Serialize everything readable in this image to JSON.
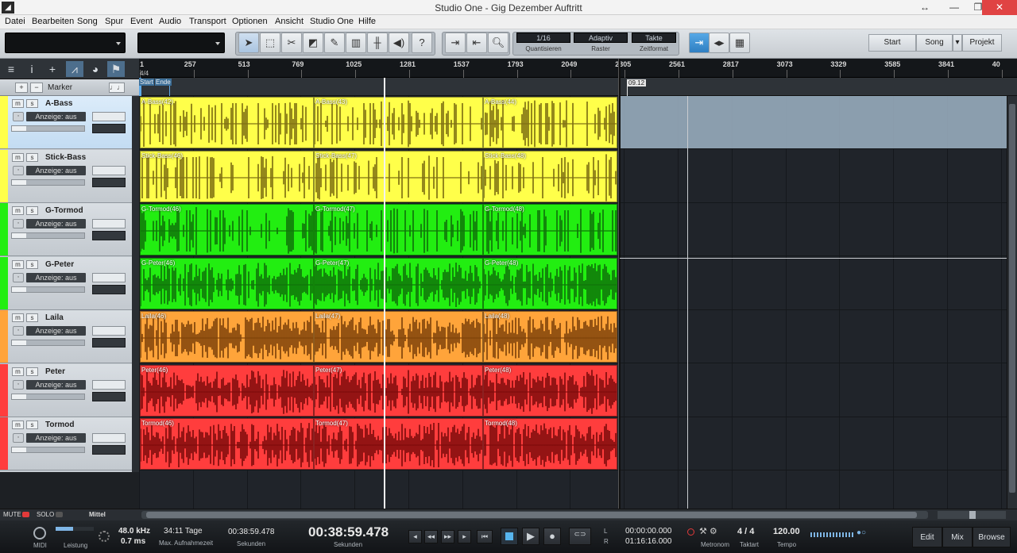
{
  "window": {
    "title": "Studio One - Gig Dezember Auftritt",
    "logo": "◢",
    "buttons": [
      "↔",
      "—",
      "❐",
      "✕"
    ]
  },
  "menu": [
    "Datei",
    "Bearbeiten",
    "Song",
    "Spur",
    "Event",
    "Audio",
    "Transport",
    "Optionen",
    "Ansicht",
    "Studio One",
    "Hilfe"
  ],
  "toolbar": {
    "quantize_value": "1/16",
    "quantize_label": "Quantisieren",
    "snap_value": "Adaptiv",
    "snap_label": "Raster",
    "timeformat_value": "Takte",
    "timeformat_label": "Zeitformat",
    "help": "?",
    "nav": {
      "start": "Start",
      "song": "Song",
      "project": "Projekt"
    }
  },
  "sidebar": {
    "marker_label": "Marker",
    "plus": "+",
    "minus": "−"
  },
  "ruler": {
    "ticks": [
      "1",
      "257",
      "513",
      "769",
      "1025",
      "1281",
      "1537",
      "1793",
      "2049",
      "2305",
      "2561",
      "2817",
      "3073",
      "3329",
      "3585",
      "3841",
      "40"
    ],
    "signature": "4/4",
    "start_marker": "Start",
    "end_marker": "Ende",
    "marker_date": "09.12"
  },
  "track_controls": {
    "mute": "m",
    "solo": "s",
    "display": "Anzeige: aus",
    "monitor": "◦"
  },
  "tracks": [
    {
      "name": "A-Bass",
      "color": "#ffff4a",
      "wave": "#7a6a10",
      "clips": [
        "A-Bass(42)",
        "A-Bass(43)",
        "A-Bass(44)"
      ]
    },
    {
      "name": "Stick-Bass",
      "color": "#ffff4a",
      "wave": "#7a6a10",
      "clips": [
        "Stick-Bass(46)",
        "Stick-Bass(47)",
        "Stick-Bass(48)"
      ]
    },
    {
      "name": "G-Tormod",
      "color": "#22ee11",
      "wave": "#0f6f0a",
      "clips": [
        "G-Tormod(46)",
        "G-Tormod(47)",
        "G-Tormod(48)"
      ]
    },
    {
      "name": "G-Peter",
      "color": "#22ee11",
      "wave": "#0f6f0a",
      "clips": [
        "G-Peter(46)",
        "G-Peter(47)",
        "G-Peter(48)"
      ]
    },
    {
      "name": "Laila",
      "color": "#ffa43a",
      "wave": "#7a3f08",
      "clips": [
        "Laila(46)",
        "Laila(47)",
        "Laila(48)"
      ]
    },
    {
      "name": "Peter",
      "color": "#ff3d3d",
      "wave": "#7a0a0a",
      "clips": [
        "Peter(46)",
        "Peter(47)",
        "Peter(48)"
      ]
    },
    {
      "name": "Tormod",
      "color": "#ff3d3d",
      "wave": "#7a0a0a",
      "clips": [
        "Tormod(46)",
        "Tormod(47)",
        "Tormod(48)"
      ]
    }
  ],
  "bottom": {
    "mute": "MUTE",
    "solo": "SOLO",
    "mode": "Mittel"
  },
  "transport": {
    "midi_label": "MIDI",
    "perf_label": "Leistung",
    "samplerate": "48.0 kHz",
    "latency": "0.7 ms",
    "rec_days": "34:11 Tage",
    "rec_label": "Max. Aufnahmezeit",
    "seconds_small": "00:38:59.478",
    "seconds_small_label": "Sekunden",
    "seconds_big": "00:38:59.478",
    "seconds_big_label": "Sekunden",
    "loop_start": "00:00:00.000",
    "loop_end": "01:16:16.000",
    "loop_l": "L",
    "loop_r": "R",
    "metronome_label": "Metronom",
    "timesig": "4 / 4",
    "timesig_label": "Taktart",
    "tempo": "120.00",
    "tempo_label": "Tempo",
    "views": {
      "edit": "Edit",
      "mix": "Mix",
      "browse": "Browse"
    }
  },
  "colors": {
    "playhead": "#f2f2f2",
    "selection": "#9fb4c6"
  }
}
